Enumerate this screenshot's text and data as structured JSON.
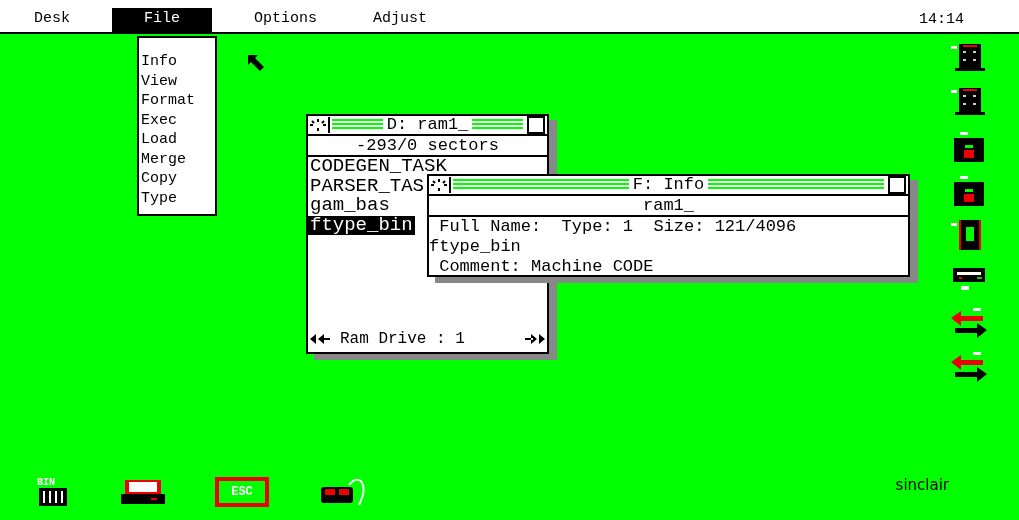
{
  "menu_bar": {
    "items": [
      {
        "label": "Desk",
        "selected": false
      },
      {
        "label": "File",
        "selected": true
      },
      {
        "label": "Options",
        "selected": false
      },
      {
        "label": "Adjust",
        "selected": false
      }
    ],
    "clock": "14:14"
  },
  "file_menu": {
    "items": [
      "Info",
      "View",
      "Format",
      "Exec",
      "Load",
      "Merge",
      "Copy",
      "Type"
    ]
  },
  "directory_window": {
    "title": "D: ram1_",
    "header": "-293/0 sectors",
    "files": [
      {
        "name": "CODEGEN_TASK",
        "selected": false
      },
      {
        "name": "PARSER_TAS",
        "selected": false
      },
      {
        "name": "gam_bas",
        "selected": false
      },
      {
        "name": "ftype_bin",
        "selected": true
      }
    ],
    "footer": "Ram Drive : 1"
  },
  "info_window": {
    "title": "F: Info",
    "header": "ram1_",
    "lines": [
      " Full Name:  Type: 1  Size: 121/4096",
      "ftype_bin",
      " Comment: Machine CODE"
    ]
  },
  "bin_label": "BIN",
  "esc_label": "ESC",
  "logo": "sinclair"
}
